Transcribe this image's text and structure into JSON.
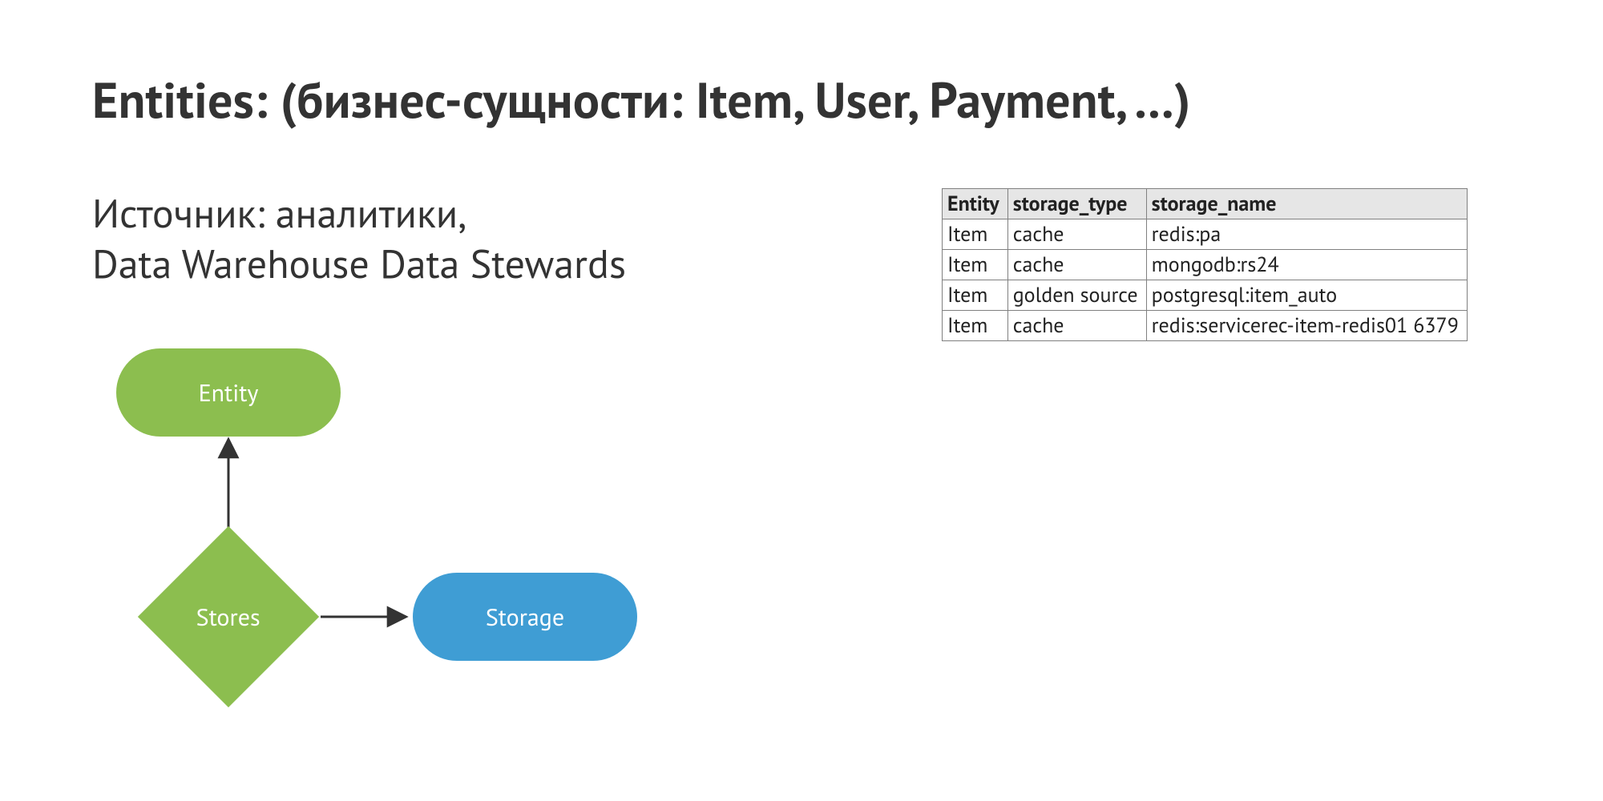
{
  "title": "Entities: (бизнес-сущности: Item, User, Payment, …)",
  "subtitle_line1": "Источник: аналитики,",
  "subtitle_line2": "Data Warehouse Data Stewards",
  "diagram": {
    "entity_label": "Entity",
    "stores_label": "Stores",
    "storage_label": "Storage"
  },
  "table": {
    "headers": {
      "c0": "Entity",
      "c1": "storage_type",
      "c2": "storage_name"
    },
    "rows": [
      {
        "c0": "Item",
        "c1": "cache",
        "c2": "redis:pa"
      },
      {
        "c0": "Item",
        "c1": "cache",
        "c2": "mongodb:rs24"
      },
      {
        "c0": "Item",
        "c1": "golden source",
        "c2": "postgresql:item_auto"
      },
      {
        "c0": "Item",
        "c1": "cache",
        "c2": "redis:servicerec-item-redis01 6379"
      }
    ]
  }
}
